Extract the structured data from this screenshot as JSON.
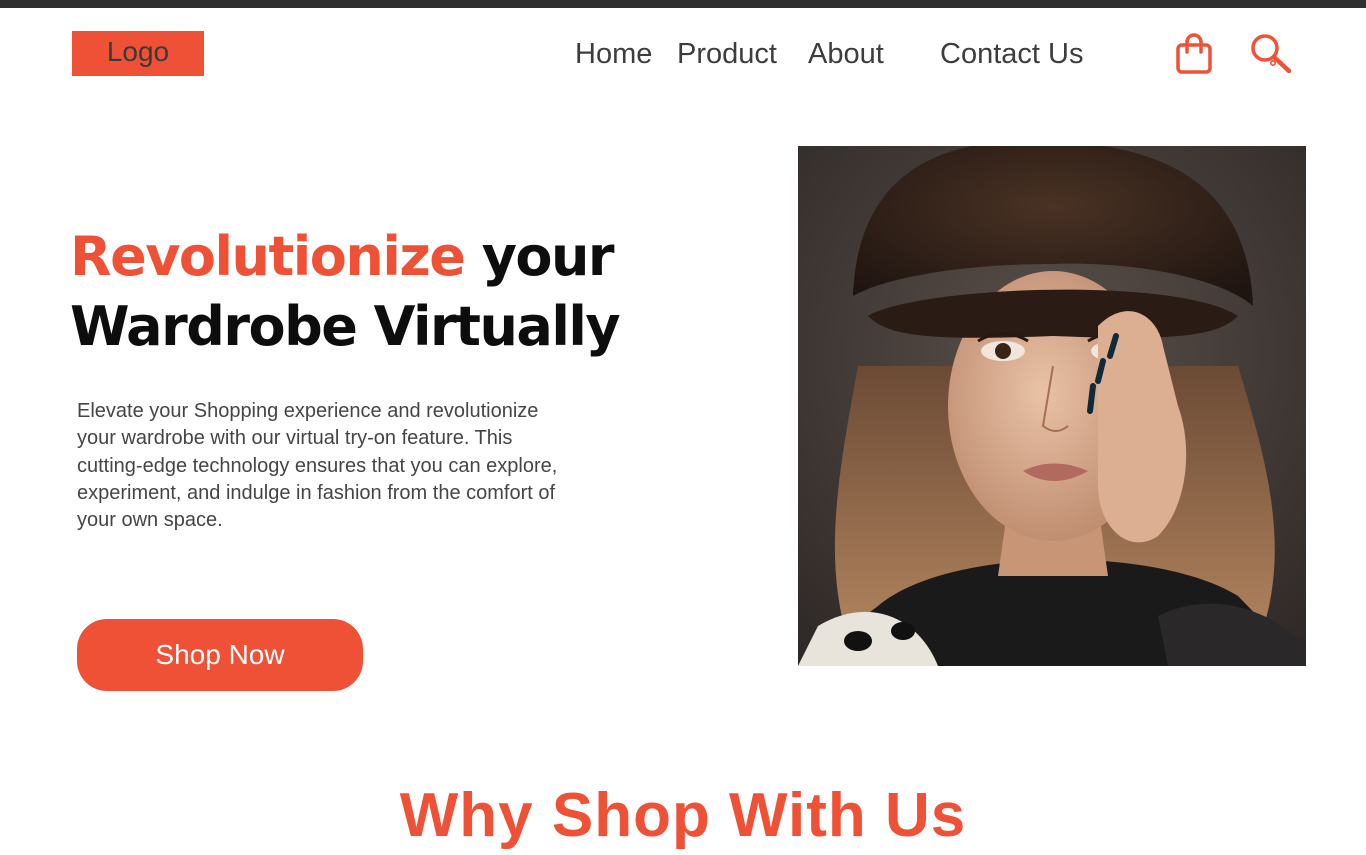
{
  "header": {
    "logo_label": "Logo",
    "nav": [
      {
        "label": "Home"
      },
      {
        "label": "Product"
      },
      {
        "label": "About"
      },
      {
        "label": "Contact Us"
      }
    ],
    "icons": [
      "shopping-bag-icon",
      "search-icon"
    ]
  },
  "hero": {
    "title_accent": "Revolutionize",
    "title_rest_line1": " your",
    "title_line2": "Wardrobe Virtually",
    "description": "Elevate your Shopping experience and revolutionize your wardrobe with our virtual try-on feature. This cutting-edge technology ensures that you can explore, experiment, and indulge in fashion from the comfort of your own space.",
    "cta_label": "Shop Now"
  },
  "section": {
    "why_title": "Why Shop With Us"
  },
  "colors": {
    "accent": "#ef5136",
    "text_dark": "#0d0d0d",
    "text_body": "#454545",
    "top_strip": "#2f2f2f"
  }
}
